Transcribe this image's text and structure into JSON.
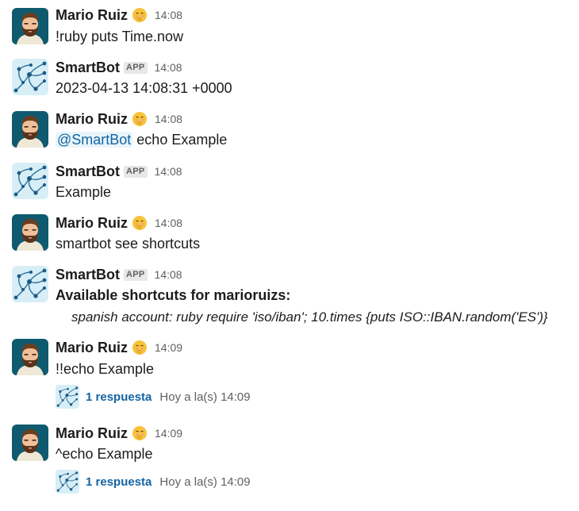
{
  "messages": [
    {
      "author": "Mario Ruiz",
      "avatar": "mario-avatar",
      "status_emoji": "face-with-hand-over-mouth-icon",
      "time": "14:08",
      "text": "!ruby puts Time.now"
    },
    {
      "author": "SmartBot",
      "avatar": "smartbot-avatar",
      "badge": "APP",
      "time": "14:08",
      "text": "2023-04-13 14:08:31 +0000"
    },
    {
      "author": "Mario Ruiz",
      "avatar": "mario-avatar",
      "status_emoji": "face-with-hand-over-mouth-icon",
      "time": "14:08",
      "mention": "@SmartBot",
      "text": " echo Example"
    },
    {
      "author": "SmartBot",
      "avatar": "smartbot-avatar",
      "badge": "APP",
      "time": "14:08",
      "text": "Example"
    },
    {
      "author": "Mario Ruiz",
      "avatar": "mario-avatar",
      "status_emoji": "face-with-hand-over-mouth-icon",
      "time": "14:08",
      "text": "smartbot see shortcuts"
    },
    {
      "author": "SmartBot",
      "avatar": "smartbot-avatar",
      "badge": "APP",
      "time": "14:08",
      "heading": "Available shortcuts for marioruizs:",
      "detail": "spanish account: ruby require 'iso/iban'; 10.times {puts ISO::IBAN.random('ES')}"
    },
    {
      "author": "Mario Ruiz",
      "avatar": "mario-avatar",
      "status_emoji": "face-with-hand-over-mouth-icon",
      "time": "14:09",
      "text": "!!echo Example",
      "thread": {
        "replies": "1 respuesta",
        "last_reply": "Hoy a la(s) 14:09"
      }
    },
    {
      "author": "Mario Ruiz",
      "avatar": "mario-avatar",
      "status_emoji": "face-with-hand-over-mouth-icon",
      "time": "14:09",
      "text": "^echo Example",
      "thread": {
        "replies": "1 respuesta",
        "last_reply": "Hoy a la(s) 14:09"
      }
    }
  ],
  "colors": {
    "link": "#1264a3",
    "mention_bg": "#e8f5fa",
    "timestamp": "#616061",
    "badge_bg": "#e8e8e8"
  }
}
